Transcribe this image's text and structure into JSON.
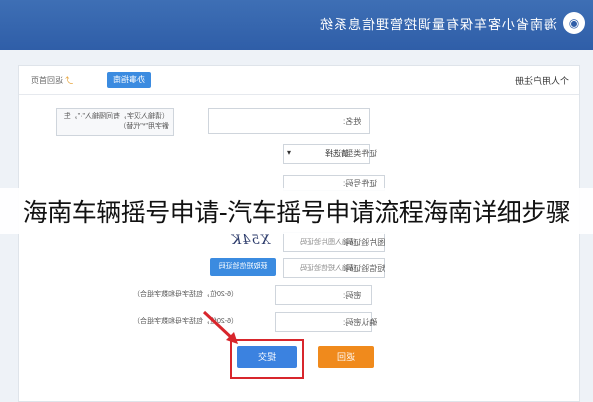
{
  "header": {
    "system_title": "海南省小客车保有量调控管理信息系统",
    "logo_icon": "logo-icon"
  },
  "panel": {
    "title": "个人用户注册",
    "back_list_button": "办事指南",
    "home_link": "返回首页"
  },
  "form": {
    "rows": [
      {
        "label": "姓名:",
        "hint": "（请输入汉字，有间隔输入\"·\"，生僻字用\"*\"代替）"
      },
      {
        "label": "证件类型:",
        "select": "请选择"
      },
      {
        "label": "证件号码:"
      },
      {
        "label": "图片验证码:",
        "placeholder": "请输入图片验证码",
        "captcha": "X54K"
      },
      {
        "label": "短信验证码:",
        "placeholder": "请输入短信验证码",
        "sms_button": "获取短信验证码"
      },
      {
        "label": "密码:",
        "hint": "（6-20位，包括字母和数字组合）"
      },
      {
        "label": "确认密码:",
        "hint": "（6-20位，包括字母和数字组合）"
      }
    ],
    "submit_label": "提交",
    "return_label": "返回"
  },
  "overlay_caption": "海南车辆摇号申请-汽车摇号申请流程海南详细步骤",
  "colors": {
    "header": "#2f5ea8",
    "primary_button": "#3b82e0",
    "return_button": "#f08a1c",
    "highlight": "#d8262c"
  }
}
